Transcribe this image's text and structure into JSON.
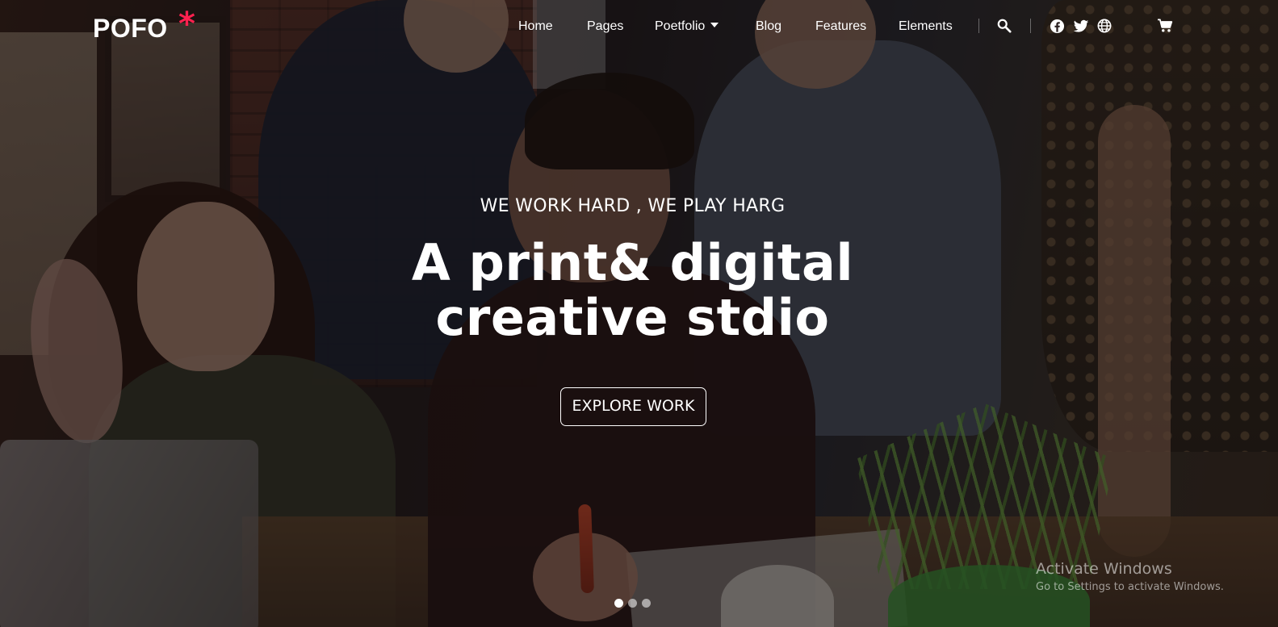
{
  "brand": {
    "logo_text": "POFO",
    "logo_mark": "*",
    "accent_color": "#ff214f"
  },
  "nav": {
    "items": [
      {
        "label": "Home"
      },
      {
        "label": "Pages"
      },
      {
        "label": "Poetfolio",
        "has_dropdown": true
      },
      {
        "label": "Blog"
      },
      {
        "label": "Features"
      },
      {
        "label": "Elements"
      }
    ],
    "icons": [
      "search-icon",
      "facebook-icon",
      "twitter-icon",
      "globe-icon",
      "shopping-cart-icon"
    ]
  },
  "hero": {
    "eyebrow": "WE WORK HARD , WE PLAY HARG",
    "headline_line1": "A print& digital",
    "headline_line2": "creative stdio",
    "cta_label": "EXPLORE WORK",
    "slides": 3,
    "active_slide": 1
  },
  "watermark": {
    "title": "Activate Windows",
    "subtitle": "Go to Settings to activate Windows."
  }
}
